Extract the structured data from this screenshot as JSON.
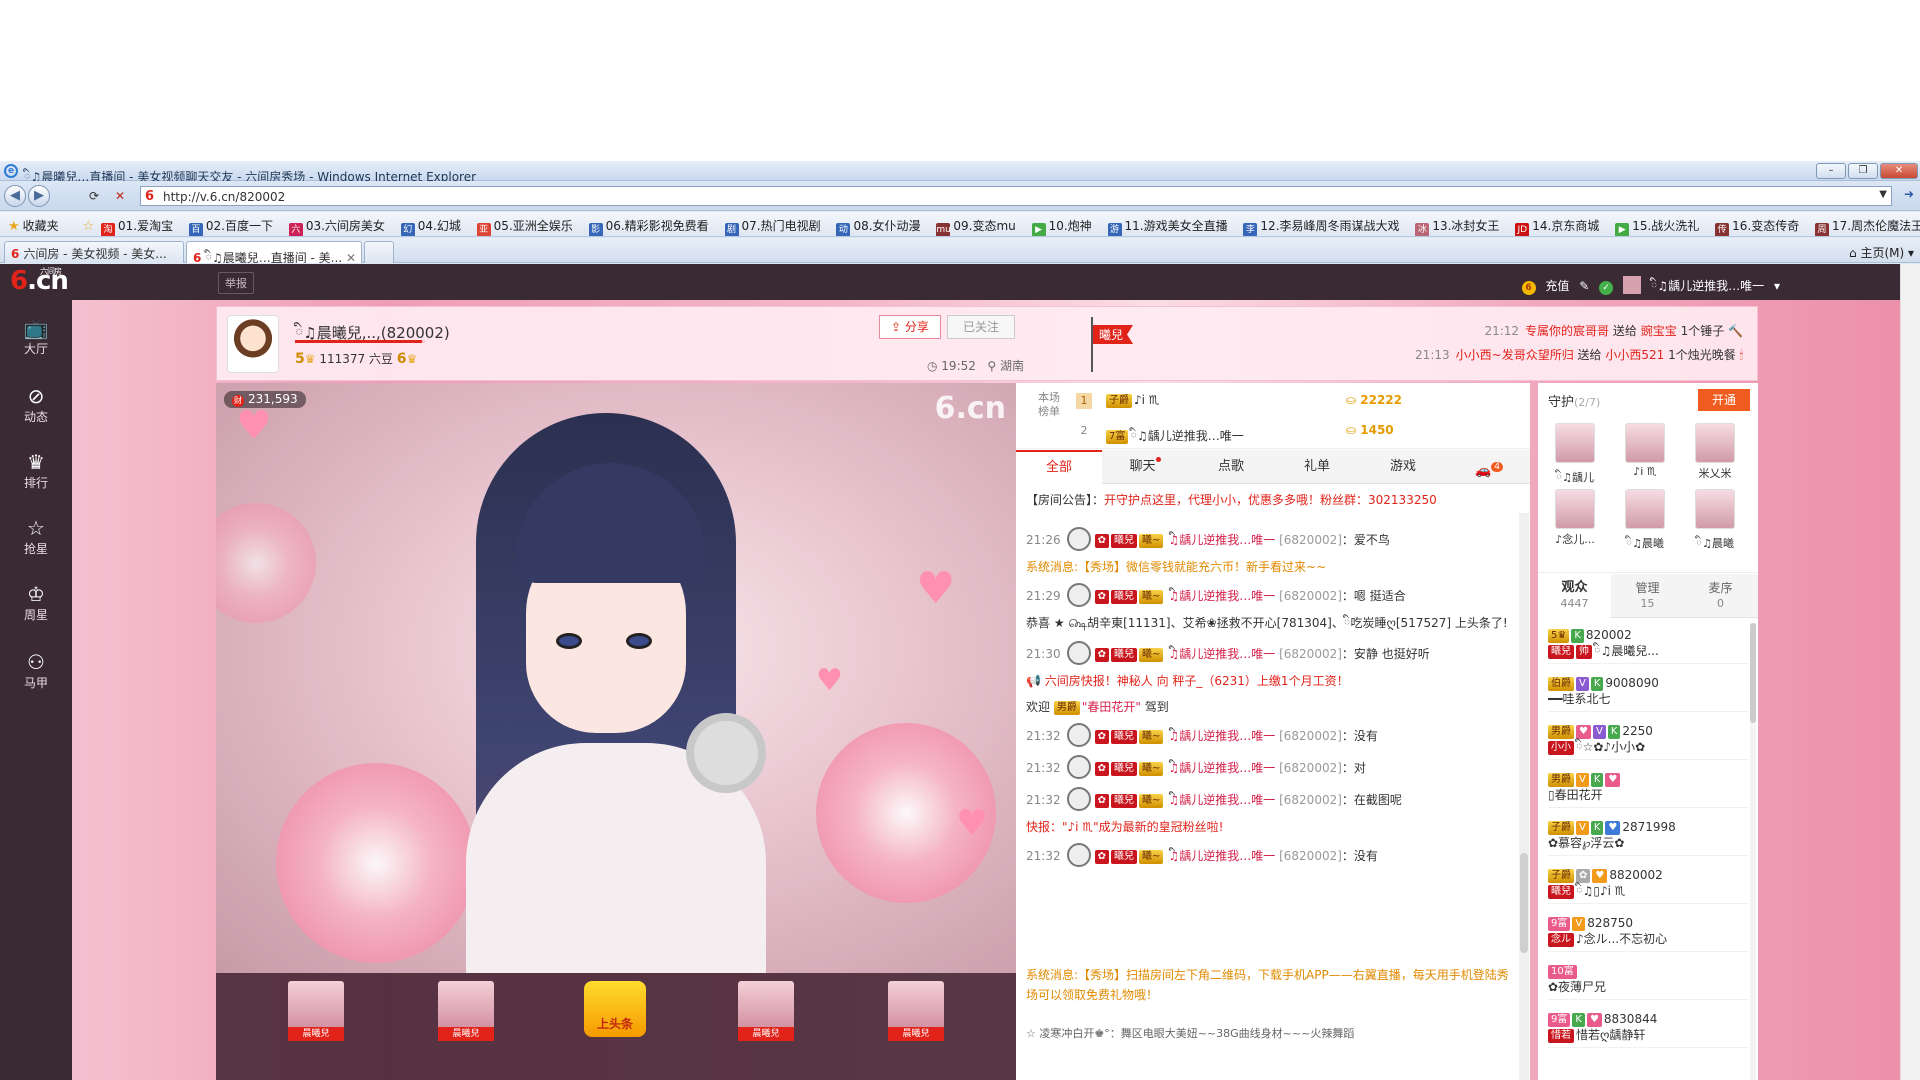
{
  "browser": {
    "window_title": "ི♫晨曦兒…直播间 - 美女视频聊天交友 - 六间房秀场 - Windows Internet Explorer",
    "url": "http://v.6.cn/820002",
    "favorites_label": "收藏夹",
    "favorites": [
      "01.爱淘宝",
      "02.百度一下",
      "03.六间房美女",
      "04.幻城",
      "05.亚洲全娱乐",
      "06.精彩影视免费看",
      "07.热门电视剧",
      "08.女仆动漫",
      "09.变态mu",
      "10.炮神",
      "11.游戏美女全直播",
      "12.李易峰周冬雨谋战大戏",
      "13.冰封女王",
      "14.京东商城",
      "15.战火洗礼",
      "16.变态传奇",
      "17.周杰伦魔法王座"
    ],
    "tabs": [
      "六间房 - 美女视频 - 美女...",
      "ི♫晨曦兒…直播间 - 美..."
    ],
    "home_label": "主页(M)"
  },
  "site": {
    "logo_text": ".cn",
    "logo_sub": "六间房",
    "report_label": "举报",
    "recharge_label": "充值",
    "user_name": "ི♫龋儿逆推我…唯一",
    "nav": [
      "大厅",
      "动态",
      "排行",
      "抢星",
      "周星",
      "马甲"
    ]
  },
  "room": {
    "host_name": "ི♫晨曦兒,..,(820002)",
    "level_left": "5",
    "beans": "111377 六豆",
    "level_right": "6",
    "share_label": "分享",
    "follow_label": "已关注",
    "time": "19:52",
    "location": "湖南",
    "flag_text": "曦兒",
    "gift_feed": [
      {
        "time": "21:12",
        "from": "专属你的宸哥哥",
        "verb": "送给",
        "to": "豌宝宝",
        "gift": "1个锤子"
      },
      {
        "time": "21:13",
        "from": "小小西~发哥众望所归",
        "verb": "送给",
        "to": "小小西521",
        "gift": "1个烛光晚餐"
      }
    ]
  },
  "video": {
    "watermark": "6.cn",
    "viewer_count": "231,593",
    "bottom_thumbs": [
      "晨曦兒",
      "晨曦兒",
      "上头条",
      "晨曦兒",
      "晨曦兒"
    ]
  },
  "chat": {
    "rank_label": "本场榜单",
    "rank": [
      {
        "no": "1",
        "name": "♪i ♏",
        "score": "22222"
      },
      {
        "no": "2",
        "name": "ི♫龋儿逆推我…唯一",
        "score": "1450"
      }
    ],
    "tabs": [
      "全部",
      "聊天",
      "点歌",
      "礼单",
      "游戏"
    ],
    "car_count": "4",
    "notice_prefix": "【房间公告】：",
    "notice_text": "开守护点这里，代理小小，优惠多多哦！粉丝群：302133250",
    "messages": [
      {
        "type": "user",
        "time": "21:26",
        "user": "ི♫龋儿逆推我…唯一",
        "id": "[6820002]",
        "text": "：爱不鸟"
      },
      {
        "type": "sys",
        "text": "系统消息:【秀场】微信零钱就能充六币！新手看过来~~"
      },
      {
        "type": "user",
        "time": "21:29",
        "user": "ི♫龋儿逆推我…唯一",
        "id": "[6820002]",
        "text": "：嗯 挺适合"
      },
      {
        "type": "gift",
        "text": "恭喜 ★ ௸胡辛東[11131]、艾希❀拯救不开心[781304]、ི吃炭睡ღ[517527] 上头条了!"
      },
      {
        "type": "user",
        "time": "21:30",
        "user": "ི♫龋儿逆推我…唯一",
        "id": "[6820002]",
        "text": "：安静 也挺好听"
      },
      {
        "type": "sys2",
        "text": "六间房快报！神秘人 向 秤子_（6231）上缴1个月工资！"
      },
      {
        "type": "welcome",
        "text": "欢迎",
        "name": "\"春田花开\"",
        "tail": "驾到"
      },
      {
        "type": "user",
        "time": "21:32",
        "user": "ི♫龋儿逆推我…唯一",
        "id": "[6820002]",
        "text": "：没有"
      },
      {
        "type": "user",
        "time": "21:32",
        "user": "ི♫龋儿逆推我…唯一",
        "id": "[6820002]",
        "text": "：对"
      },
      {
        "type": "user",
        "time": "21:32",
        "user": "ི♫龋儿逆推我…唯一",
        "id": "[6820002]",
        "text": "：在截图呢"
      },
      {
        "type": "sys",
        "text": "快报：\"♪i ♏\"成为最新的皇冠粉丝啦!"
      },
      {
        "type": "user",
        "time": "21:32",
        "user": "ི♫龋儿逆推我…唯一",
        "id": "[6820002]",
        "text": "：没有"
      }
    ],
    "system_bottom": "系统消息:【秀场】扫描房间左下角二维码，下载手机APP——右翼直播，每天用手机登陆秀场可以领取免费礼物哦！",
    "last_line": "☆ 凌寒冲白开♚°：舞区电眼大美妞~~38G曲线身材~~~火辣舞蹈"
  },
  "guard": {
    "title": "守护",
    "count": "(2/7)",
    "open_label": "开通",
    "members": [
      "ི♫龋儿",
      "♪i ♏",
      "米乂米",
      "♪念儿...",
      "ི♫晨曦",
      "ི♫晨曦"
    ]
  },
  "audience": {
    "tabs": [
      {
        "label": "观众",
        "count": "4447"
      },
      {
        "label": "管理",
        "count": "15"
      },
      {
        "label": "麦序",
        "count": "0"
      }
    ],
    "list": [
      {
        "id": "820002",
        "nick": "ི♫晨曦兒..."
      },
      {
        "id": "9008090",
        "nick": "━━哇系北七"
      },
      {
        "id": "2250",
        "nick": "ི☆✿♪小小✿"
      },
      {
        "id": "",
        "nick": "▯春田花开"
      },
      {
        "id": "2871998",
        "nick": "✿慕容℘浮云✿"
      },
      {
        "id": "8820002",
        "nick": "ི♫▯♪i ♏"
      },
      {
        "id": "828750",
        "nick": "♪念ル...不忘初心"
      },
      {
        "id": "",
        "nick": "✿夜薄尸兄"
      },
      {
        "id": "8830844",
        "nick": "惜若ღ龋静轩"
      }
    ]
  },
  "colors": {
    "brand_red": "#e2231a",
    "nav_dark": "#3a2a33",
    "page_pink": "#f4b8c9"
  }
}
